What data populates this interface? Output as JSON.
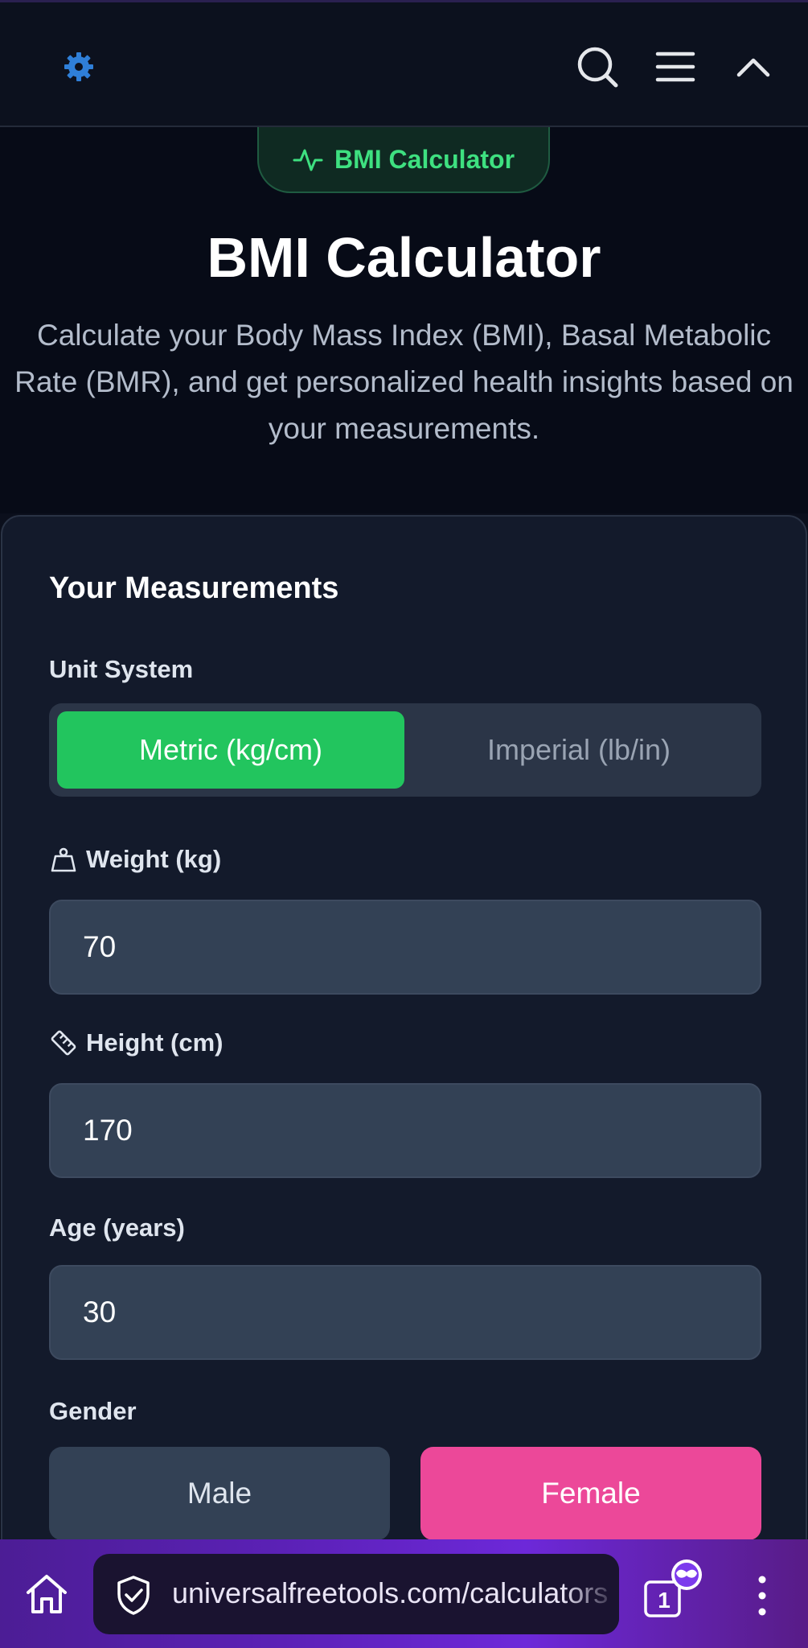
{
  "header": {
    "logo_icon": "gear-logo-icon",
    "icons": [
      "search-icon",
      "menu-icon",
      "chevron-up-icon"
    ]
  },
  "hero": {
    "badge_label": "BMI Calculator",
    "title": "BMI Calculator",
    "description_lines": [
      "Calculate your Body Mass Index (BMI), Basal Metabolic",
      "Rate (BMR), and get personalized health insights based on",
      "your measurements."
    ]
  },
  "form": {
    "section_title": "Your Measurements",
    "unit_system_label": "Unit System",
    "unit_options": {
      "metric": "Metric (kg/cm)",
      "imperial": "Imperial (lb/in)"
    },
    "weight_label": "Weight (kg)",
    "weight_value": "70",
    "height_label": "Height (cm)",
    "height_value": "170",
    "age_label": "Age (years)",
    "age_value": "30",
    "gender_label": "Gender",
    "gender_options": {
      "male": "Male",
      "female": "Female"
    }
  },
  "browser": {
    "url": "universalfreetools.com/calculators",
    "tab_count": "1"
  },
  "colors": {
    "accent_green": "#22c55e",
    "accent_pink": "#ec4899",
    "bottom_bar_purple": "#5b21b6"
  }
}
